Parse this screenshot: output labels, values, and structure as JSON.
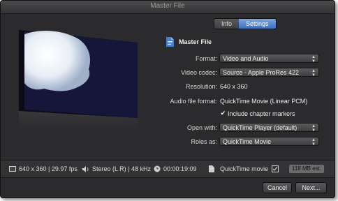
{
  "window": {
    "title": "Master File"
  },
  "tabs": [
    {
      "label": "Info"
    },
    {
      "label": "Settings"
    }
  ],
  "file": {
    "name": "Master File"
  },
  "settings": {
    "format": {
      "label": "Format:",
      "value": "Video and Audio"
    },
    "video_codec": {
      "label": "Video codec:",
      "value": "Source - Apple ProRes 422"
    },
    "resolution": {
      "label": "Resolution:",
      "value": "640 x 360"
    },
    "audio_format": {
      "label": "Audio file format:",
      "value": "QuickTime Movie (Linear PCM)"
    },
    "chapter_markers": {
      "label": "Include chapter markers",
      "checked": true
    },
    "open_with": {
      "label": "Open with:",
      "value": "QuickTime Player (default)"
    },
    "roles_as": {
      "label": "Roles as:",
      "value": "QuickTime Movie"
    }
  },
  "status": {
    "video": "640 x 360 | 29.97 fps",
    "audio": "Stereo (L R) | 48 kHz",
    "duration": "00:00:19:09",
    "format": "QuickTime movie",
    "size": "118 MB est."
  },
  "buttons": {
    "cancel": "Cancel",
    "next": "Next..."
  },
  "colors": {
    "accent": "#3b6fc0",
    "background": "#2b2b2d"
  }
}
